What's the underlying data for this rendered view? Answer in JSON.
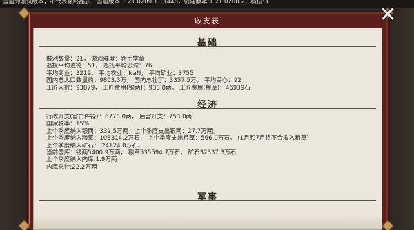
{
  "version_bar": "当前为测试版本，不代表最终品质，当前版本:1.21.0209.1.11448，创建版本:1.21.0208.2，档位:3",
  "dialog": {
    "title": "收支表",
    "close_icon": "close-x-icon"
  },
  "sections": {
    "basic": {
      "title": "基础",
      "lines": [
        "城池数量：21，     游戏难度：新手学童",
        "巡抚平均道德：51，  巡抚平均忠诚：76",
        "平均商业：3219，     平均农业：NaN，     平均矿业：3755",
        "国内总人口数量约：9803.3万，     国内总壮丁：3357.5万，     平均民心：92",
        "工匠人数：93879，     工匠费用(银两)：938.8两，     工匠费用(粮草)：46939石"
      ]
    },
    "economy": {
      "title": "经济",
      "lines": [
        "行政开支(官员俸禄）：6778.0两，     后宫开支：753.0两",
        "国家税率：15%",
        "上个季度纳入银两：332.5万两，上个季度支出银两：27.7万两。",
        "上个季度纳入粮草：108314.2万石，  上个季度支出粮草：566.0万石。   (1月和7月将不会收入粮草)",
        "上个季度纳入矿石：  24124.0万石。",
        "当前国库：银两5400.9万两，     粮草535594.7万石，     矿石32337.3万石",
        "上个季度纳入内库:1.9万两",
        "内库总计:22.2万两"
      ]
    },
    "military": {
      "title": "军事"
    }
  }
}
